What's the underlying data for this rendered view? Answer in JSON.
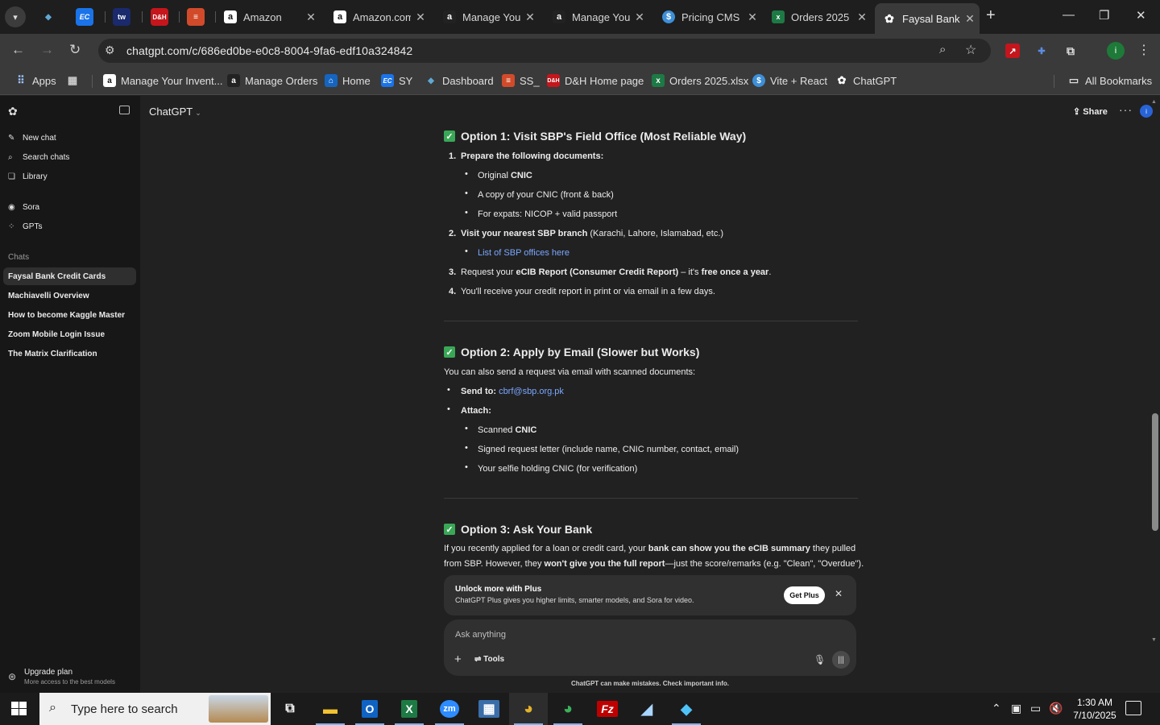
{
  "browser": {
    "pinned_tabs": [
      {
        "icon": "coinbase-style-icon",
        "glyph": "◆",
        "color": "#2f6f9f"
      },
      {
        "icon": "ec-icon",
        "glyph": "EC",
        "color": "#1a73e8"
      },
      {
        "icon": "tw-icon",
        "glyph": "tw",
        "color": "#1a2a6c"
      },
      {
        "icon": "dh-icon",
        "glyph": "■",
        "color": "#c4161c"
      },
      {
        "icon": "stack-icon",
        "glyph": "≡",
        "color": "#d14b2a"
      }
    ],
    "tabs": [
      {
        "title": "Amazon",
        "icon": "amazon-icon"
      },
      {
        "title": "Amazon.com",
        "icon": "amazon-icon"
      },
      {
        "title": "Manage Your",
        "icon": "amazon-icon"
      },
      {
        "title": "Manage Your",
        "icon": "amazon-icon"
      },
      {
        "title": "Pricing CMS",
        "icon": "dollar-icon"
      },
      {
        "title": "Orders 2025",
        "icon": "excel-icon"
      },
      {
        "title": "Faysal Bank",
        "icon": "chatgpt-icon",
        "active": true
      }
    ],
    "url": "chatgpt.com/c/686ed0be-e0c8-8004-9fa6-edf10a324842",
    "bookmarks": [
      {
        "label": "Apps",
        "icon": "apps-grid-icon"
      },
      {
        "label": "",
        "icon": "grid-icon"
      },
      {
        "label": "Manage Your Invent...",
        "icon": "amazon-icon"
      },
      {
        "label": "Manage Orders",
        "icon": "amazon-icon"
      },
      {
        "label": "Home",
        "icon": "home-bookmark-icon"
      },
      {
        "label": "SY",
        "icon": "ec-icon"
      },
      {
        "label": "Dashboard",
        "icon": "dashboard-icon"
      },
      {
        "label": "SS_",
        "icon": "stack-icon"
      },
      {
        "label": "D&H Home page",
        "icon": "dh-icon"
      },
      {
        "label": "Orders 2025.xlsx",
        "icon": "excel-icon"
      },
      {
        "label": "Vite + React",
        "icon": "dollar-icon"
      },
      {
        "label": "ChatGPT",
        "icon": "chatgpt-icon"
      }
    ],
    "all_bookmarks": "All Bookmarks",
    "profile_initial": "i"
  },
  "sidebar": {
    "top_items": [
      {
        "label": "New chat",
        "icon": "edit-icon"
      },
      {
        "label": "Search chats",
        "icon": "search-icon"
      },
      {
        "label": "Library",
        "icon": "library-icon"
      }
    ],
    "mid_items": [
      {
        "label": "Sora",
        "icon": "sora-icon"
      },
      {
        "label": "GPTs",
        "icon": "gpts-icon"
      }
    ],
    "section_label": "Chats",
    "chats": [
      "Faysal Bank Credit Cards",
      "Machiavelli Overview",
      "How to become Kaggle Master",
      "Zoom Mobile Login Issue",
      "The Matrix Clarification"
    ],
    "upgrade_title": "Upgrade plan",
    "upgrade_sub": "More access to the best models"
  },
  "header": {
    "model": "ChatGPT",
    "share": "Share",
    "avatar_initial": "i"
  },
  "content": {
    "option1_title": "Option 1: Visit SBP's Field Office (Most Reliable Way)",
    "o1_s1": "Prepare the following documents:",
    "o1_s1_b1_pre": "Original ",
    "o1_s1_b1_bold": "CNIC",
    "o1_s1_b2": "A copy of your CNIC (front & back)",
    "o1_s1_b3": "For expats: NICOP + valid passport",
    "o1_s2_bold": "Visit your nearest SBP branch",
    "o1_s2_rest": " (Karachi, Lahore, Islamabad, etc.)",
    "o1_s2_link": "List of SBP offices here",
    "o1_s3_pre": "Request your ",
    "o1_s3_bold": "eCIB Report (Consumer Credit Report)",
    "o1_s3_mid": " – it's ",
    "o1_s3_bold2": "free once a year",
    "o1_s3_end": ".",
    "o1_s4": "You'll receive your credit report in print or via email in a few days.",
    "option2_title": "Option 2: Apply by Email (Slower but Works)",
    "o2_intro": "You can also send a request via email with scanned documents:",
    "o2_send_label": "Send to:",
    "o2_send_email": "cbrf@sbp.org.pk",
    "o2_attach": "Attach:",
    "o2_a1_pre": "Scanned ",
    "o2_a1_bold": "CNIC",
    "o2_a2": "Signed request letter (include name, CNIC number, contact, email)",
    "o2_a3": "Your selfie holding CNIC (for verification)",
    "option3_title": "Option 3: Ask Your Bank",
    "o3_l1_pre": "If you recently applied for a loan or credit card, your ",
    "o3_l1_bold": "bank can show you the eCIB summary",
    "o3_l1_end": " they pulled",
    "o3_l2_pre": "from SBP. However, they ",
    "o3_l2_bold": "won't give you the full report",
    "o3_l2_end": "—just the score/remarks (e.g. \"Clean\", \"Overdue\")."
  },
  "plus_banner": {
    "title": "Unlock more with Plus",
    "subtitle": "ChatGPT Plus gives you higher limits, smarter models, and Sora for video.",
    "button": "Get Plus"
  },
  "composer": {
    "placeholder": "Ask anything",
    "tools": "Tools"
  },
  "disclaimer": "ChatGPT can make mistakes. Check important info.",
  "taskbar": {
    "search_placeholder": "Type here to search",
    "time": "1:30 AM",
    "date": "7/10/2025"
  }
}
